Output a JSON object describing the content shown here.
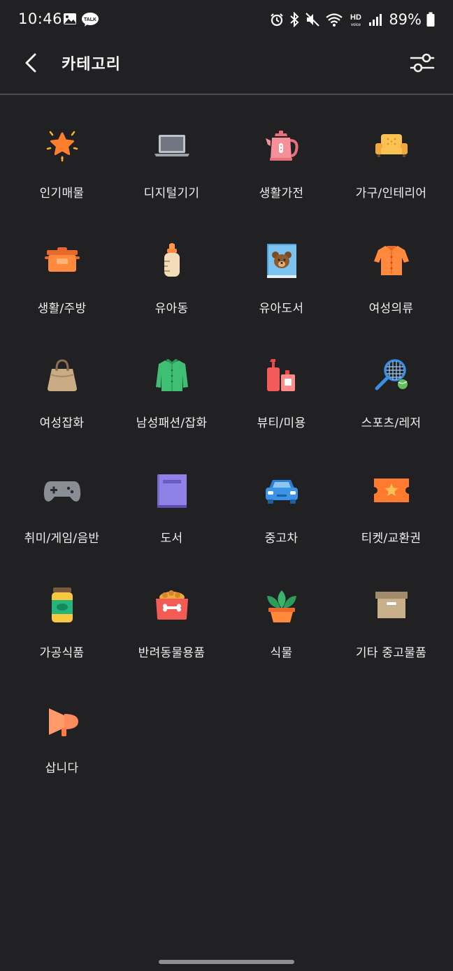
{
  "status_bar": {
    "time": "10:46",
    "battery_percent": "89%"
  },
  "header": {
    "title": "카테고리"
  },
  "categories": [
    {
      "label": "인기매물",
      "icon": "star-icon"
    },
    {
      "label": "디지털기기",
      "icon": "laptop-icon"
    },
    {
      "label": "생활가전",
      "icon": "kettle-icon"
    },
    {
      "label": "가구/인테리어",
      "icon": "sofa-icon"
    },
    {
      "label": "생활/주방",
      "icon": "pot-icon"
    },
    {
      "label": "유아동",
      "icon": "baby-bottle-icon"
    },
    {
      "label": "유아도서",
      "icon": "bear-book-icon"
    },
    {
      "label": "여성의류",
      "icon": "blouse-icon"
    },
    {
      "label": "여성잡화",
      "icon": "handbag-icon"
    },
    {
      "label": "남성패션/잡화",
      "icon": "shirt-icon"
    },
    {
      "label": "뷰티/미용",
      "icon": "cosmetics-icon"
    },
    {
      "label": "스포츠/레저",
      "icon": "tennis-racket-icon"
    },
    {
      "label": "취미/게임/음반",
      "icon": "gamepad-icon"
    },
    {
      "label": "도서",
      "icon": "book-icon"
    },
    {
      "label": "중고차",
      "icon": "car-icon"
    },
    {
      "label": "티켓/교환권",
      "icon": "ticket-icon"
    },
    {
      "label": "가공식품",
      "icon": "jar-icon"
    },
    {
      "label": "반려동물용품",
      "icon": "pet-bowl-icon"
    },
    {
      "label": "식물",
      "icon": "plant-icon"
    },
    {
      "label": "기타 중고물품",
      "icon": "box-icon"
    },
    {
      "label": "삽니다",
      "icon": "megaphone-icon"
    }
  ]
}
